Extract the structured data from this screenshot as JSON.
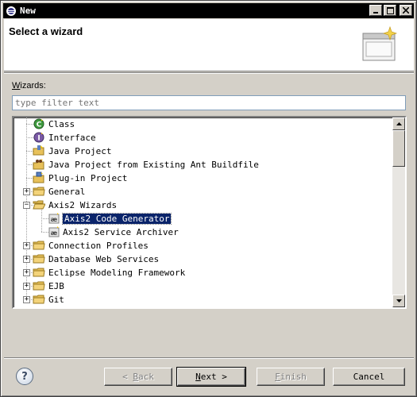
{
  "window": {
    "title": "New"
  },
  "header": {
    "title": "Select a wizard"
  },
  "wizards_label": {
    "prefix": "W",
    "rest": "izards:"
  },
  "filter": {
    "placeholder": "type filter text"
  },
  "tree": {
    "items": [
      {
        "label": "Class",
        "icon": "class-icon",
        "expandable": false
      },
      {
        "label": "Interface",
        "icon": "interface-icon",
        "expandable": false
      },
      {
        "label": "Java Project",
        "icon": "java-project-icon",
        "expandable": false
      },
      {
        "label": "Java Project from Existing Ant Buildfile",
        "icon": "ant-project-icon",
        "expandable": false
      },
      {
        "label": "Plug-in Project",
        "icon": "plugin-project-icon",
        "expandable": false
      },
      {
        "label": "General",
        "icon": "folder-icon",
        "expandable": true,
        "expanded": false
      },
      {
        "label": "Axis2 Wizards",
        "icon": "folder-open-icon",
        "expandable": true,
        "expanded": true
      },
      {
        "label": "Axis2 Code Generator",
        "icon": "axis2-icon",
        "expandable": false,
        "selected": true
      },
      {
        "label": "Axis2 Service Archiver",
        "icon": "axis2-icon",
        "expandable": false
      },
      {
        "label": "Connection Profiles",
        "icon": "folder-icon",
        "expandable": true,
        "expanded": false
      },
      {
        "label": "Database Web Services",
        "icon": "folder-icon",
        "expandable": true,
        "expanded": false
      },
      {
        "label": "Eclipse Modeling Framework",
        "icon": "folder-icon",
        "expandable": true,
        "expanded": false
      },
      {
        "label": "EJB",
        "icon": "folder-icon",
        "expandable": true,
        "expanded": false
      },
      {
        "label": "Git",
        "icon": "folder-icon",
        "expandable": true,
        "expanded": false
      }
    ]
  },
  "footer": {
    "help_icon": "?",
    "back": {
      "mnemonic": "B",
      "rest": "ack",
      "prefix": "< ",
      "enabled": false
    },
    "next": {
      "mnemonic": "N",
      "rest": "ext",
      "suffix": " >",
      "enabled": true
    },
    "finish": {
      "mnemonic": "F",
      "rest": "inish",
      "enabled": false
    },
    "cancel": {
      "label": "Cancel",
      "enabled": true
    }
  },
  "colors": {
    "selection": "#0a246a",
    "titlebar": "#000000",
    "dialog_bg": "#d4d0c8",
    "folder": "#e8c15a"
  }
}
